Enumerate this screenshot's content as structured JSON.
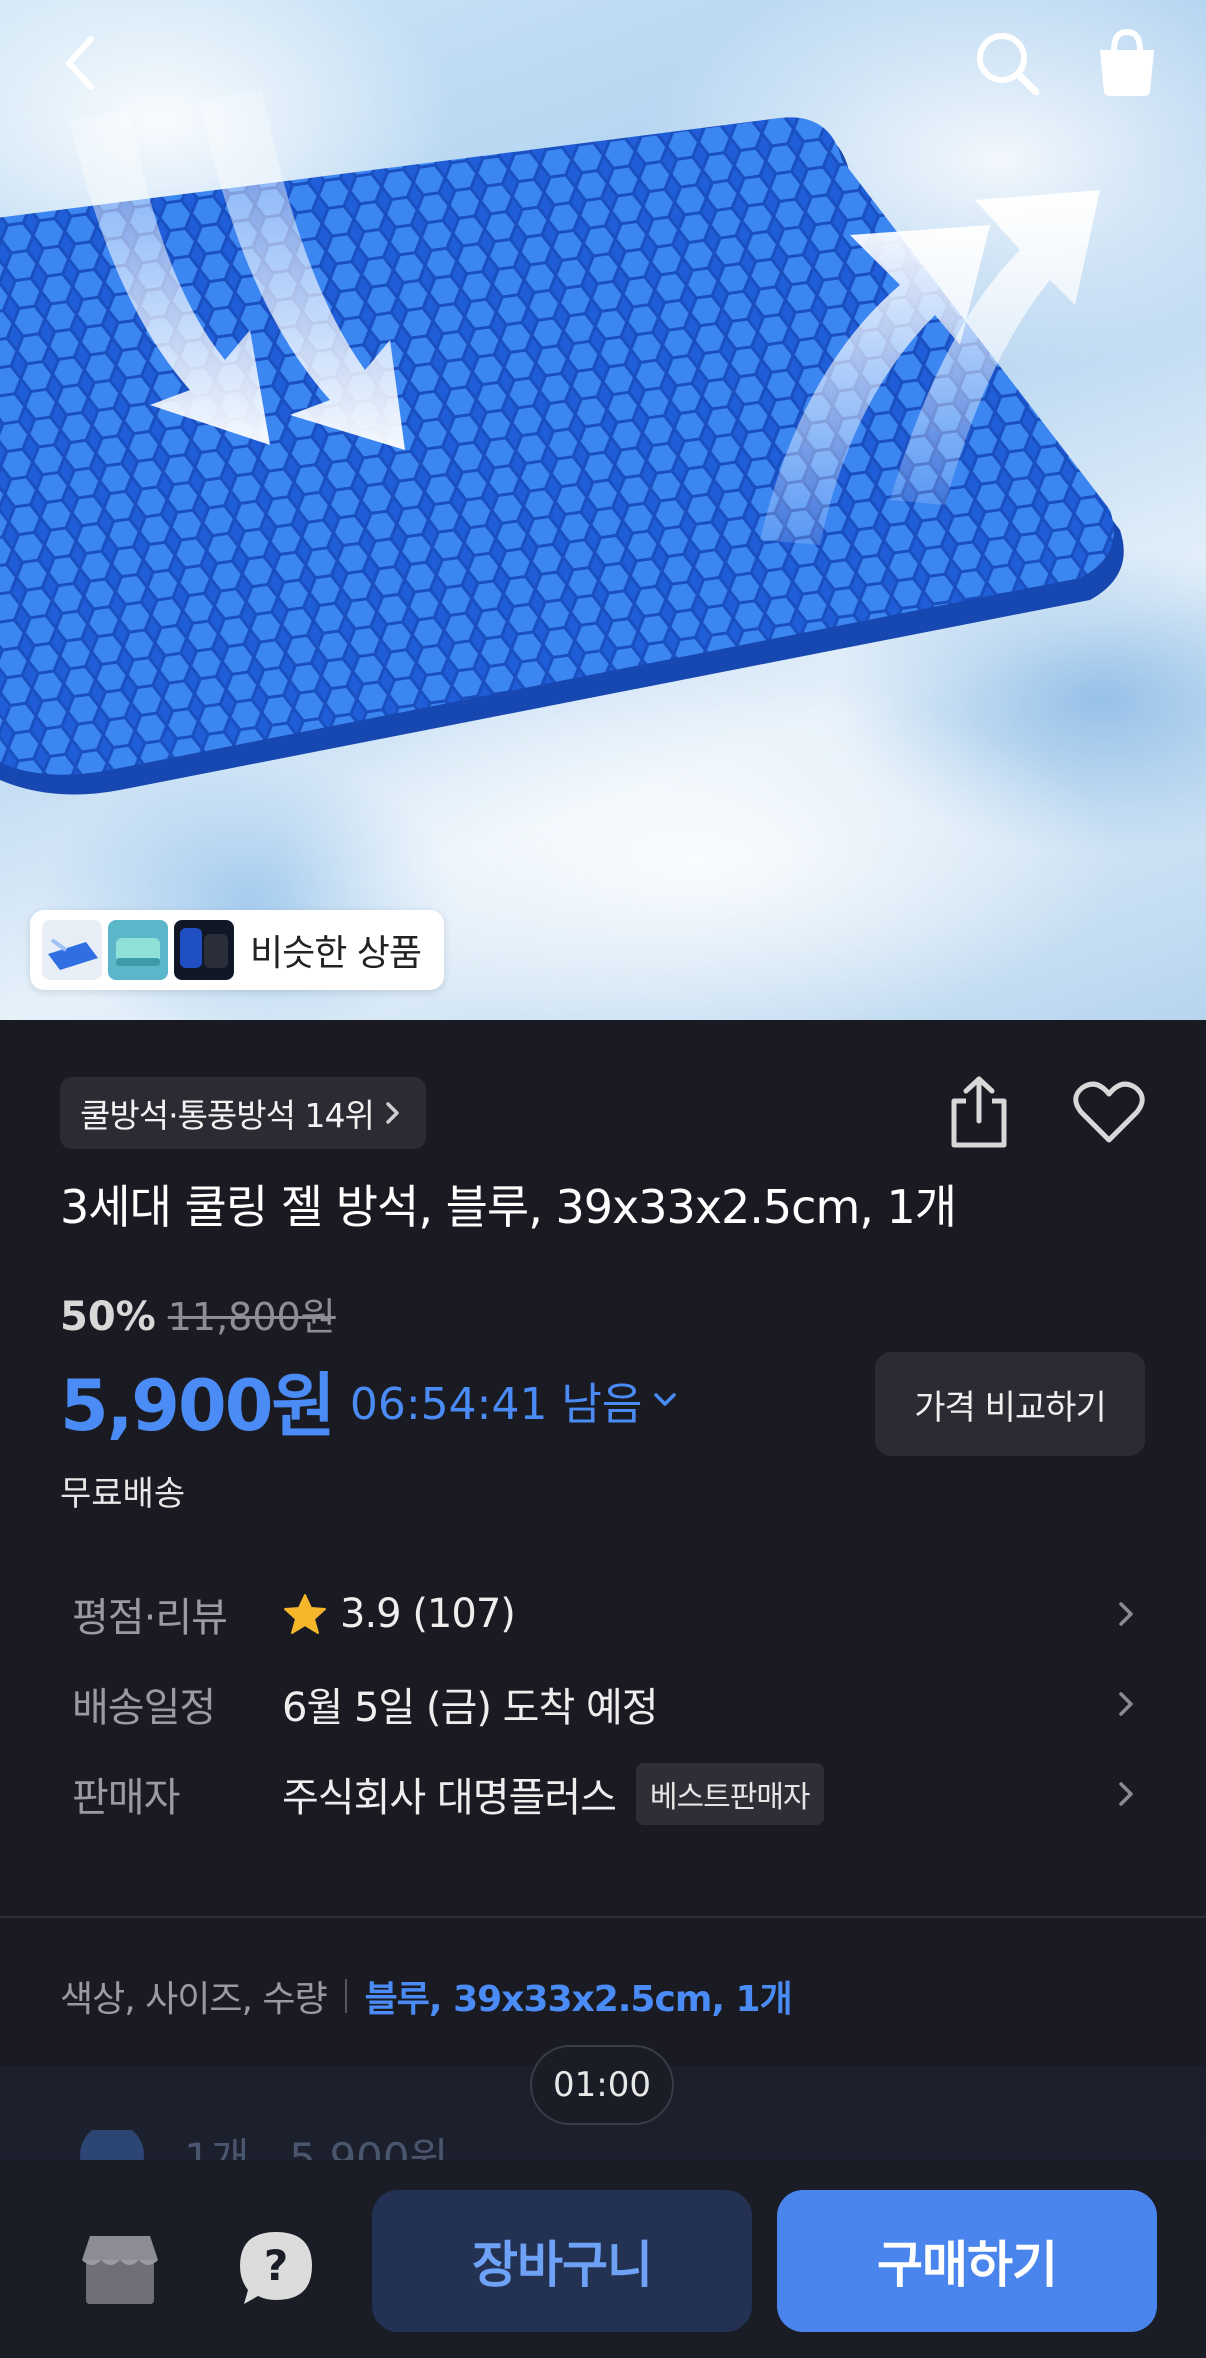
{
  "hero": {
    "similar_products_label": "비슷한 상품"
  },
  "icons": {
    "back": "back-arrow-icon",
    "search": "search-icon",
    "cart": "shopping-bag-icon",
    "share": "share-icon",
    "wishlist": "heart-icon",
    "rating": "star-icon",
    "store": "store-icon",
    "help": "question-icon"
  },
  "colors": {
    "accent": "#4a8bf5",
    "background": "#1a1a22",
    "buy_button": "#4a85ee",
    "cart_button": "#233152",
    "star": "#f6b62b"
  },
  "product": {
    "rank_badge": "쿨방석·통풍방석 14위",
    "title": "3세대 쿨링 젤 방석, 블루, 39x33x2.5cm, 1개",
    "discount_percent": "50%",
    "original_price": "11,800원",
    "price": "5,900원",
    "time_left": "06:54:41 남음",
    "compare_label": "가격 비교하기",
    "shipping": "무료배송"
  },
  "info_rows": {
    "rating": {
      "label": "평점·리뷰",
      "value": "3.9 (107)"
    },
    "delivery": {
      "label": "배송일정",
      "value": "6월 5일 (금) 도착 예정"
    },
    "seller": {
      "label": "판매자",
      "value": "주식회사 대명플러스",
      "badge": "베스트판매자"
    }
  },
  "option": {
    "label": "색상, 사이즈, 수량",
    "value": "블루, 39x33x2.5cm, 1개"
  },
  "mini_timer": "01:00",
  "ghost_row": {
    "qty": "1개",
    "price": "5,900원"
  },
  "bottom_bar": {
    "cart_label": "장바구니",
    "buy_label": "구매하기"
  }
}
